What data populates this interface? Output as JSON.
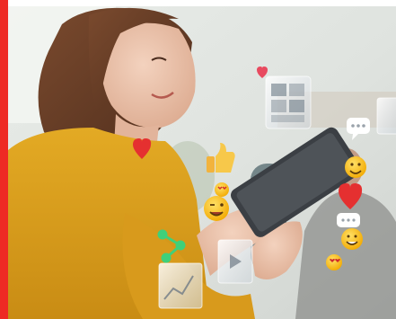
{
  "image": {
    "accent_color": "#ee2a24",
    "background_color": "#ffffff"
  },
  "floating_icons": [
    "heart-icon",
    "photo-gallery-card-icon",
    "speech-bubble-icon",
    "thumbs-up-icon",
    "smiley-emoji-icon",
    "heart-eyes-emoji-icon",
    "share-icon",
    "video-card-icon",
    "wink-emoji-icon"
  ]
}
